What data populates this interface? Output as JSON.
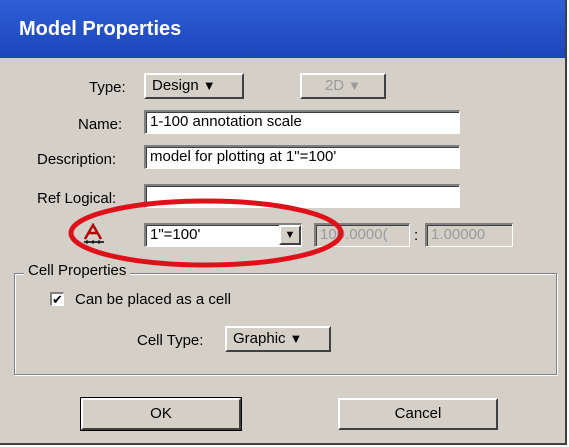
{
  "window": {
    "title": "Model Properties"
  },
  "form": {
    "type_label": "Type:",
    "type_value": "Design",
    "dimension_value": "2D",
    "name_label": "Name:",
    "name_value": "1-100 annotation scale",
    "description_label": "Description:",
    "description_value": "model for plotting at 1\"=100'",
    "ref_logical_label": "Ref Logical:",
    "ref_logical_value": "",
    "annotation_scale_value": "1\"=100'",
    "scale_numerator": "100.0000(",
    "scale_separator": ":",
    "scale_denominator": "1.00000"
  },
  "cell_properties": {
    "group_label": "Cell Properties",
    "can_be_placed_label": "Can be placed as a cell",
    "can_be_placed_checked": "✔",
    "cell_type_label": "Cell Type:",
    "cell_type_value": "Graphic"
  },
  "buttons": {
    "ok": "OK",
    "cancel": "Cancel"
  },
  "icons": {
    "annotation_scale": "annotation-scale-icon",
    "dropdown": "triangle-down"
  },
  "colors": {
    "title_bar": "#1b45b9",
    "highlight_ellipse": "#e0101a",
    "dialog_bg": "#d4d0c8"
  }
}
